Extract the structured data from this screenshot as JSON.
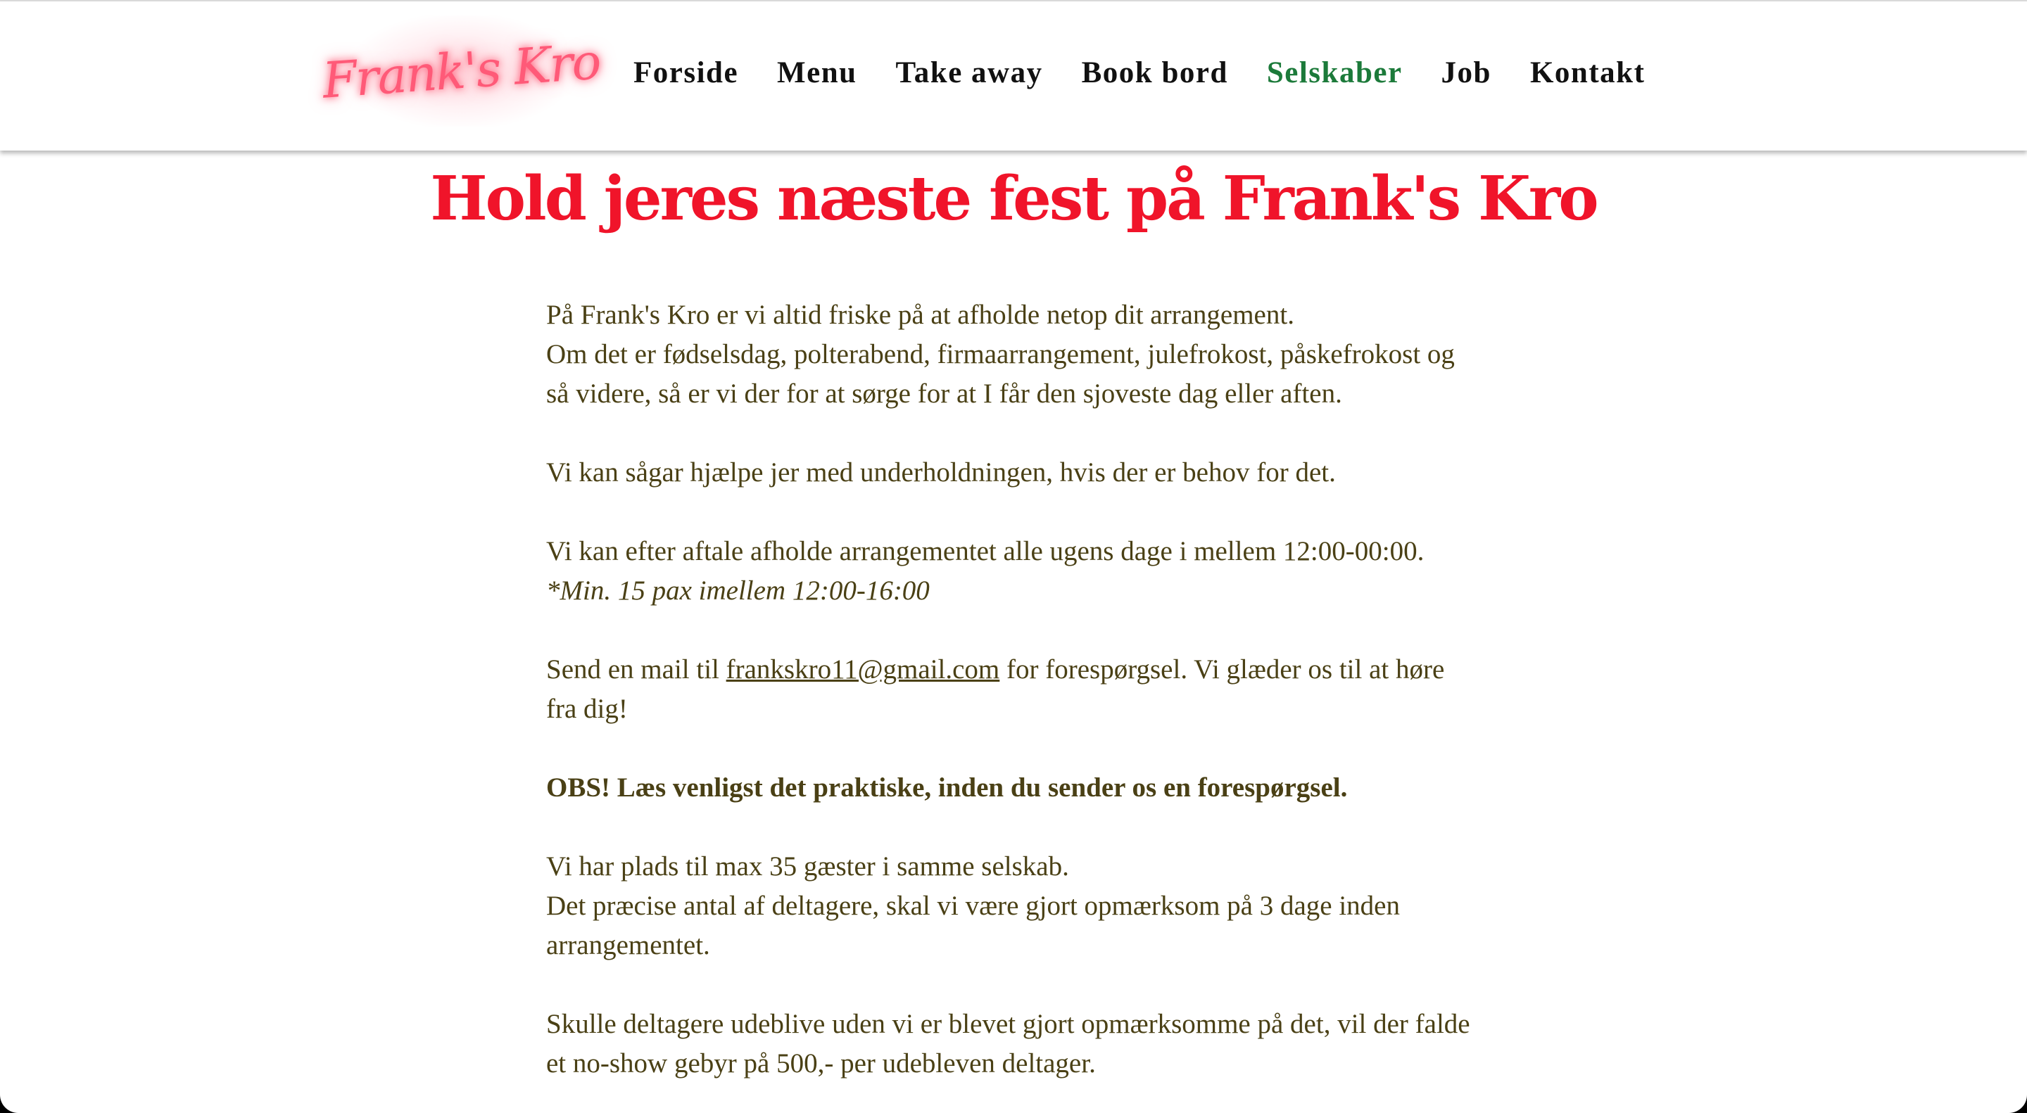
{
  "header": {
    "logo_text": "Frank's Kro",
    "nav": [
      {
        "label": "Forside",
        "active": false
      },
      {
        "label": "Menu",
        "active": false
      },
      {
        "label": "Take away",
        "active": false
      },
      {
        "label": "Book bord",
        "active": false
      },
      {
        "label": "Selskaber",
        "active": true
      },
      {
        "label": "Job",
        "active": false
      },
      {
        "label": "Kontakt",
        "active": false
      }
    ]
  },
  "main": {
    "title": "Hold jeres næste fest på Frank's Kro",
    "intro_line1": "På Frank's Kro er vi altid friske på at afholde netop dit arrangement.",
    "intro_line2": "Om det er fødselsdag, polterabend, firmaarrangement, julefrokost, påskefrokost og så videre, så er vi der for at sørge for at I får den sjoveste dag eller aften.",
    "entertainment": "Vi kan sågar hjælpe jer med underholdningen, hvis der er behov for det.",
    "hours": "Vi kan efter aftale afholde arrangementet alle ugens dage i mellem 12:00-00:00.",
    "min_pax_note": "*Min. 15 pax imellem 12:00-16:00",
    "mail_prefix": "Send en mail til ",
    "email": "frankskro11@gmail.com",
    "mail_suffix": " for forespørgsel. Vi glæder os til at høre fra dig!",
    "obs_notice": "OBS! Læs venligst det praktiske, inden du sender os en forespørgsel.",
    "capacity": "Vi har plads til max 35 gæster i samme selskab.",
    "guest_count": "Det præcise antal af deltagere, skal vi være gjort opmærksom på 3 dage inden arrangementet.",
    "no_show": "Skulle deltagere udeblive uden vi er blevet gjort opmærksomme på det, vil der falde et no-show gebyr på 500,- per udebleven deltager."
  },
  "colors": {
    "title_red": "#f0142a",
    "active_nav_green": "#1c7a3a",
    "body_text": "#4a4015",
    "logo_neon": "#ff5a78"
  }
}
